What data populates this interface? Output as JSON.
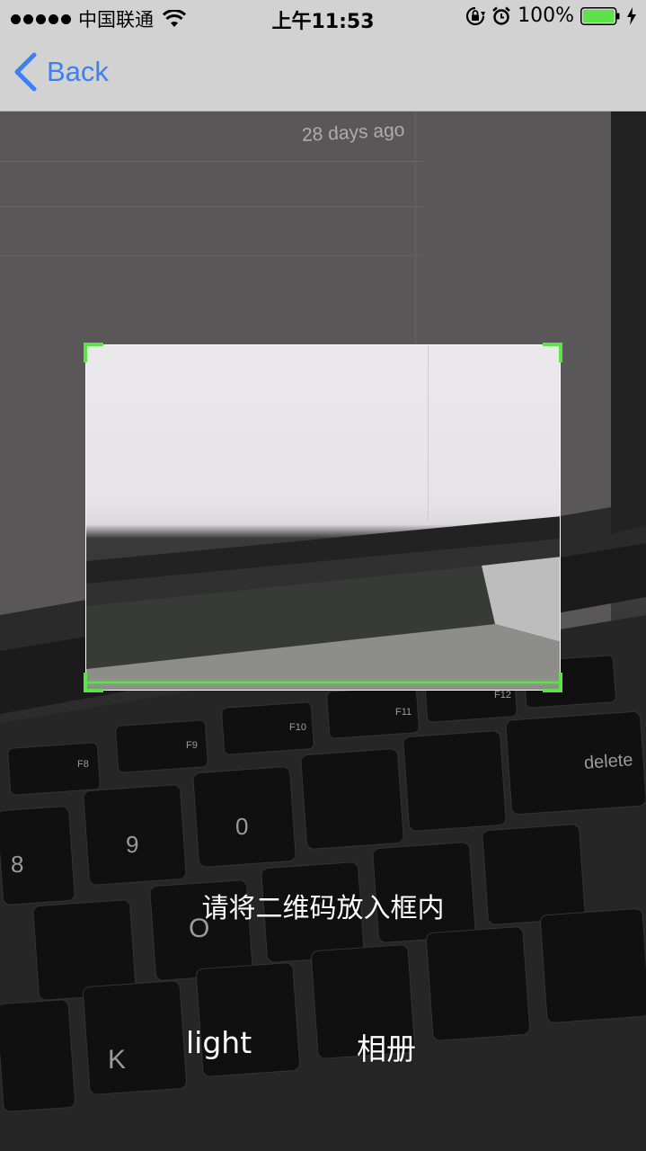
{
  "status_bar": {
    "carrier": "中国联通",
    "time": "上午11:53",
    "battery_percent": "100%",
    "battery_color": "#5ee24a",
    "icons": [
      "signal-dots-icon",
      "wifi-icon",
      "orientation-lock-icon",
      "alarm-icon",
      "battery-icon",
      "charging-bolt-icon"
    ]
  },
  "nav": {
    "back_label": "Back",
    "accent_color": "#3d80f2",
    "back_icon": "chevron-left-icon"
  },
  "camera": {
    "background_text": "28 days ago",
    "keyboard_labels": {
      "f8": "F8",
      "f9": "F9",
      "f10": "F10",
      "f11": "F11",
      "f12": "F12",
      "delete": "delete",
      "nine": "9",
      "zero": "0",
      "eight": "8",
      "k": "K",
      "o": "O"
    }
  },
  "scanner": {
    "frame_corner_color": "#5ee24a",
    "hint": "请将二维码放入框内"
  },
  "actions": {
    "light_label": "light",
    "album_label": "相册"
  }
}
